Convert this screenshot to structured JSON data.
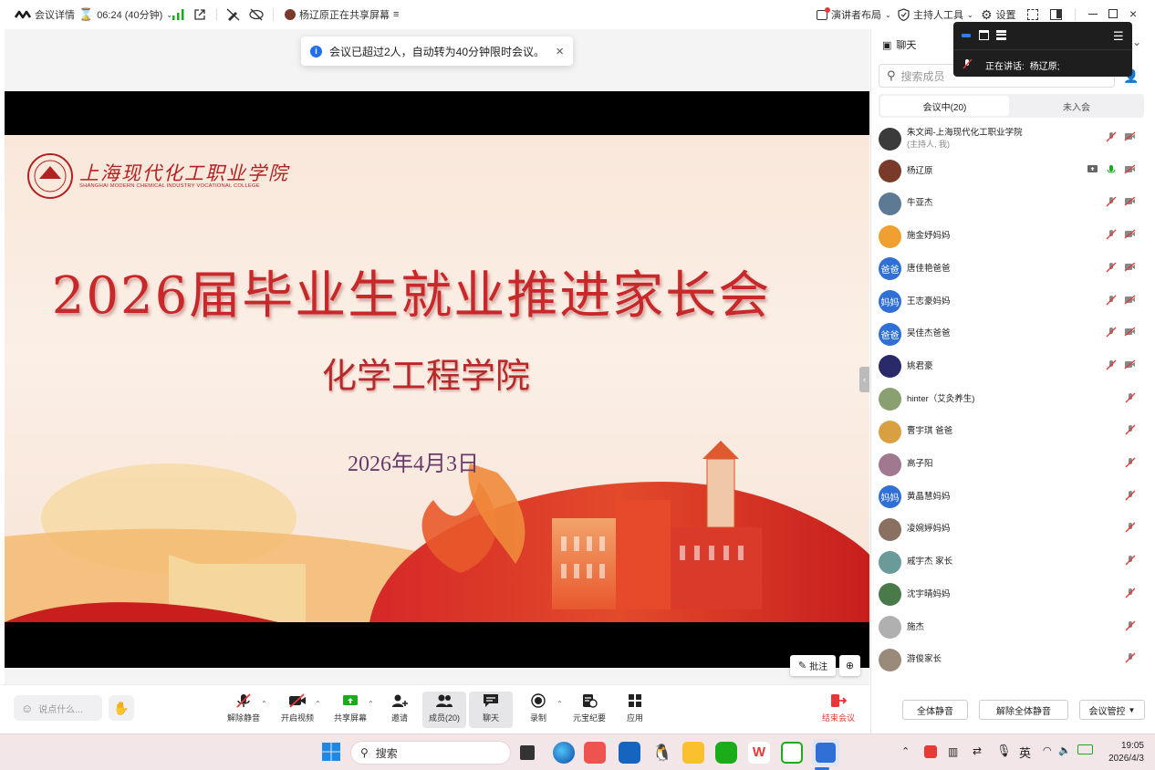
{
  "topbar": {
    "meeting_details": "会议详情",
    "timer": "06:24 (40分钟)",
    "sharing_status": "杨辽原正在共享屏幕",
    "presenter_layout": "演讲者布局",
    "host_tools": "主持人工具",
    "settings": "设置"
  },
  "toast": {
    "message": "会议已超过2人，自动转为40分钟限时会议。"
  },
  "speaking_bar": {
    "label": "正在讲话:",
    "speaker": "杨辽原;"
  },
  "slide": {
    "school_cn": "上海现代化工职业学院",
    "school_en": "SHANGHAI MODERN CHEMICAL INDUSTRY VOCATIONAL COLLEGE",
    "title": "2026届毕业生就业推进家长会",
    "subtitle": "化学工程学院",
    "date": "2026年4月3日"
  },
  "annotate": {
    "label": "批注"
  },
  "bottombar": {
    "chat_placeholder": "说点什么...",
    "unmute": "解除静音",
    "start_video": "开启视频",
    "share_screen": "共享屏幕",
    "invite": "邀请",
    "members": "成员(20)",
    "chat": "聊天",
    "record": "录制",
    "yuanbao": "元宝纪要",
    "apps": "应用",
    "end_meeting": "结束会议"
  },
  "panel": {
    "chat_title": "聊天",
    "search_placeholder": "搜索成员",
    "tab_in_meeting": "会议中(20)",
    "tab_not_joined": "未入会",
    "mute_all": "全体静音",
    "unmute_all": "解除全体静音",
    "meeting_control": "会议管控",
    "members": [
      {
        "name": "朱文闻-上海现代化工职业学院",
        "sub": "(主持人, 我)",
        "avatar": "",
        "color": "#3b3b3b",
        "video": true,
        "screen": false,
        "mic_on": false
      },
      {
        "name": "杨辽原",
        "sub": "",
        "avatar": "",
        "color": "#7a3a2a",
        "video": true,
        "screen": true,
        "mic_on": true
      },
      {
        "name": "牛亚杰",
        "sub": "",
        "avatar": "",
        "color": "#5c7a94",
        "video": true,
        "screen": false,
        "mic_on": false
      },
      {
        "name": "施金妤妈妈",
        "sub": "",
        "avatar": "",
        "color": "#f0a030",
        "video": true,
        "screen": false,
        "mic_on": false
      },
      {
        "name": "唐佳艳爸爸",
        "sub": "",
        "avatar": "爸爸",
        "color": "#2f6fd6",
        "video": true,
        "screen": false,
        "mic_on": false
      },
      {
        "name": "王志豪妈妈",
        "sub": "",
        "avatar": "妈妈",
        "color": "#2f6fd6",
        "video": true,
        "screen": false,
        "mic_on": false
      },
      {
        "name": "吴佳杰爸爸",
        "sub": "",
        "avatar": "爸爸",
        "color": "#2f6fd6",
        "video": true,
        "screen": false,
        "mic_on": false
      },
      {
        "name": "姚君豪",
        "sub": "",
        "avatar": "",
        "color": "#2a2a6a",
        "video": true,
        "screen": false,
        "mic_on": false
      },
      {
        "name": "hinter（艾灸养生)",
        "sub": "",
        "avatar": "",
        "color": "#8aa070",
        "video": false,
        "screen": false,
        "mic_on": false
      },
      {
        "name": "曹宇琪 爸爸",
        "sub": "",
        "avatar": "",
        "color": "#d8a040",
        "video": false,
        "screen": false,
        "mic_on": false
      },
      {
        "name": "高子阳",
        "sub": "",
        "avatar": "",
        "color": "#a07890",
        "video": false,
        "screen": false,
        "mic_on": false
      },
      {
        "name": "黄晶慧妈妈",
        "sub": "",
        "avatar": "妈妈",
        "color": "#2f6fd6",
        "video": false,
        "screen": false,
        "mic_on": false
      },
      {
        "name": "凌婉婷妈妈",
        "sub": "",
        "avatar": "",
        "color": "#8a7060",
        "video": false,
        "screen": false,
        "mic_on": false
      },
      {
        "name": "戚宇杰 家长",
        "sub": "",
        "avatar": "",
        "color": "#6a9a9a",
        "video": false,
        "screen": false,
        "mic_on": false
      },
      {
        "name": "沈宇晴妈妈",
        "sub": "",
        "avatar": "",
        "color": "#4a7a4a",
        "video": false,
        "screen": false,
        "mic_on": false
      },
      {
        "name": "施杰",
        "sub": "",
        "avatar": "",
        "color": "#b0b0b0",
        "video": false,
        "screen": false,
        "mic_on": false
      },
      {
        "name": "游俊家长",
        "sub": "",
        "avatar": "",
        "color": "#9a8a7a",
        "video": false,
        "screen": false,
        "mic_on": false
      }
    ]
  },
  "taskbar": {
    "search": "搜索",
    "ime": "英",
    "time": "19:05",
    "date": "2026/4/3"
  }
}
